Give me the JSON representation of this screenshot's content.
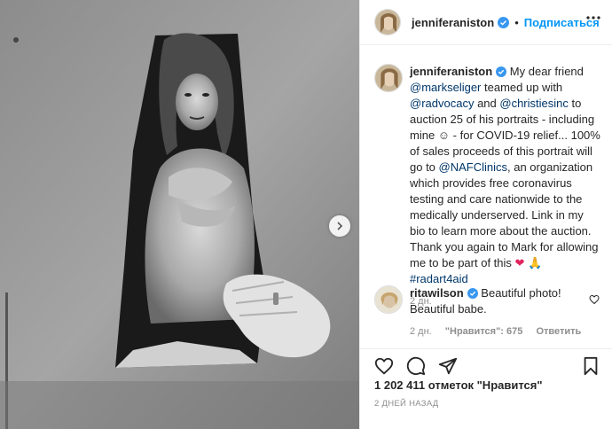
{
  "header": {
    "username": "jenniferaniston",
    "separator": "•",
    "follow_label": "Подписаться"
  },
  "caption": {
    "username": "jenniferaniston",
    "t1": " My dear friend ",
    "m1": "@markseliger",
    "t2": " teamed up with ",
    "m2": "@radvocacy",
    "t3": " and ",
    "m3": "@christiesinc",
    "t4": " to auction 25 of his portraits - including mine ☺ - for COVID-19 relief... 100% of sales proceeds of this portrait will go to ",
    "m4": "@NAFClinics",
    "t5": ", an organization which provides free coronavirus testing and care nationwide to the medically underserved. Link in my bio to learn more about the auction. Thank you again to Mark for allowing me to be part of this ",
    "emoji": "❤ 🙏 ",
    "hashtag": "#radart4aid",
    "time": "2 дн."
  },
  "comment": {
    "username": "ritawilson",
    "text": " Beautiful photo! Beautiful babe.",
    "time": "2 дн.",
    "likes": "\"Нравится\": 675",
    "reply": "Ответить"
  },
  "likes_text": "1 202 411 отметок \"Нравится\"",
  "date_text": "2 ДНЕЙ НАЗАД",
  "icons": {
    "like": "heart-icon",
    "comment": "comment-icon",
    "share": "share-icon",
    "save": "bookmark-icon",
    "next": "chevron-right-icon",
    "more": "more-icon",
    "verified": "verified-badge-icon"
  },
  "colors": {
    "link": "#00376b",
    "follow": "#0095f6",
    "verified": "#3897f0",
    "muted": "#8e8e8e"
  }
}
